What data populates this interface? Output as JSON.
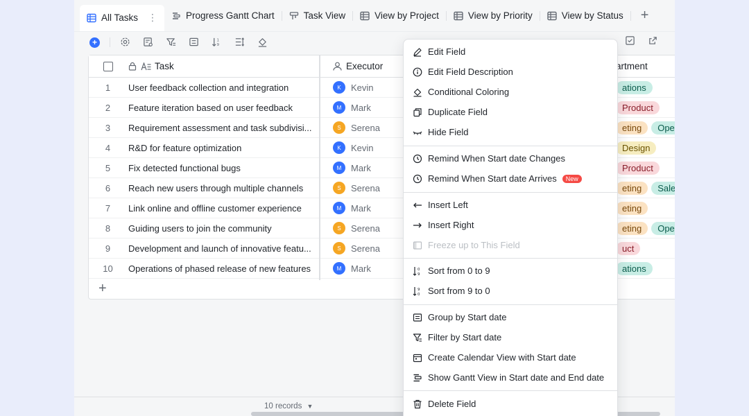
{
  "tabs": [
    {
      "label": "All Tasks",
      "icon": "grid-table-icon",
      "active": true
    },
    {
      "label": "Progress Gantt Chart",
      "icon": "gantt-icon"
    },
    {
      "label": "Task View",
      "icon": "kanban-icon"
    },
    {
      "label": "View by Project",
      "icon": "grid-table-icon"
    },
    {
      "label": "View by Priority",
      "icon": "grid-table-icon"
    },
    {
      "label": "View by Status",
      "icon": "grid-table-icon"
    }
  ],
  "columns": {
    "task": "Task",
    "executor": "Executor",
    "department": "artment"
  },
  "rows": [
    {
      "num": "1",
      "task": "User feedback collection and integration",
      "executor": "Kevin",
      "initial": "K",
      "color": "#3370ff",
      "depts": [
        {
          "label": "ations",
          "bg": "#c8ede5",
          "fg": "#0b5c4c"
        }
      ]
    },
    {
      "num": "2",
      "task": "Feature iteration based on user feedback",
      "executor": "Mark",
      "initial": "M",
      "color": "#3370ff",
      "depts": [
        {
          "label": "Product",
          "bg": "#f9d8db",
          "fg": "#8a1f2b"
        }
      ]
    },
    {
      "num": "3",
      "task": "Requirement assessment and task subdivisi...",
      "executor": "Serena",
      "initial": "S",
      "color": "#f5a623",
      "depts": [
        {
          "label": "eting",
          "bg": "#fbe2c2",
          "fg": "#7a4a0c"
        },
        {
          "label": "Opera",
          "bg": "#c8ede5",
          "fg": "#0b5c4c"
        }
      ]
    },
    {
      "num": "4",
      "task": "R&D for feature optimization",
      "executor": "Kevin",
      "initial": "K",
      "color": "#3370ff",
      "depts": [
        {
          "label": "Design",
          "bg": "#f6edc0",
          "fg": "#6b5300"
        }
      ]
    },
    {
      "num": "5",
      "task": "Fix detected functional bugs",
      "executor": "Mark",
      "initial": "M",
      "color": "#3370ff",
      "depts": [
        {
          "label": "Product",
          "bg": "#f9d8db",
          "fg": "#8a1f2b"
        }
      ]
    },
    {
      "num": "6",
      "task": "Reach new users through multiple channels",
      "executor": "Serena",
      "initial": "S",
      "color": "#f5a623",
      "depts": [
        {
          "label": "eting",
          "bg": "#fbe2c2",
          "fg": "#7a4a0c"
        },
        {
          "label": "Sales",
          "bg": "#c8ede5",
          "fg": "#0b5c4c"
        }
      ]
    },
    {
      "num": "7",
      "task": "Link online and offline customer experience",
      "executor": "Mark",
      "initial": "M",
      "color": "#3370ff",
      "depts": [
        {
          "label": "eting",
          "bg": "#fbe2c2",
          "fg": "#7a4a0c"
        }
      ]
    },
    {
      "num": "8",
      "task": "Guiding users to join the community",
      "executor": "Serena",
      "initial": "S",
      "color": "#f5a623",
      "depts": [
        {
          "label": "eting",
          "bg": "#fbe2c2",
          "fg": "#7a4a0c"
        },
        {
          "label": "Opera",
          "bg": "#c8ede5",
          "fg": "#0b5c4c"
        }
      ]
    },
    {
      "num": "9",
      "task": "Development and launch of innovative featu...",
      "executor": "Serena",
      "initial": "S",
      "color": "#f5a623",
      "depts": [
        {
          "label": "uct",
          "bg": "#f9d8db",
          "fg": "#8a1f2b"
        }
      ]
    },
    {
      "num": "10",
      "task": "Operations of phased release of new features",
      "executor": "Mark",
      "initial": "M",
      "color": "#3370ff",
      "depts": [
        {
          "label": "ations",
          "bg": "#c8ede5",
          "fg": "#0b5c4c"
        }
      ]
    }
  ],
  "status": {
    "records": "10 records"
  },
  "menu": {
    "edit_field": "Edit Field",
    "edit_description": "Edit Field Description",
    "conditional_coloring": "Conditional Coloring",
    "duplicate_field": "Duplicate Field",
    "hide_field": "Hide Field",
    "remind_changes": "Remind When Start date Changes",
    "remind_arrives": "Remind When Start date Arrives",
    "new_badge": "New",
    "insert_left": "Insert Left",
    "insert_right": "Insert Right",
    "freeze": "Freeze up to This Field",
    "sort_asc": "Sort from 0 to 9",
    "sort_desc": "Sort from 9 to 0",
    "group_by": "Group by Start date",
    "filter_by": "Filter by Start date",
    "calendar_view": "Create Calendar View with Start date",
    "gantt_view": "Show Gantt View in Start date and End date",
    "delete_field": "Delete Field"
  }
}
